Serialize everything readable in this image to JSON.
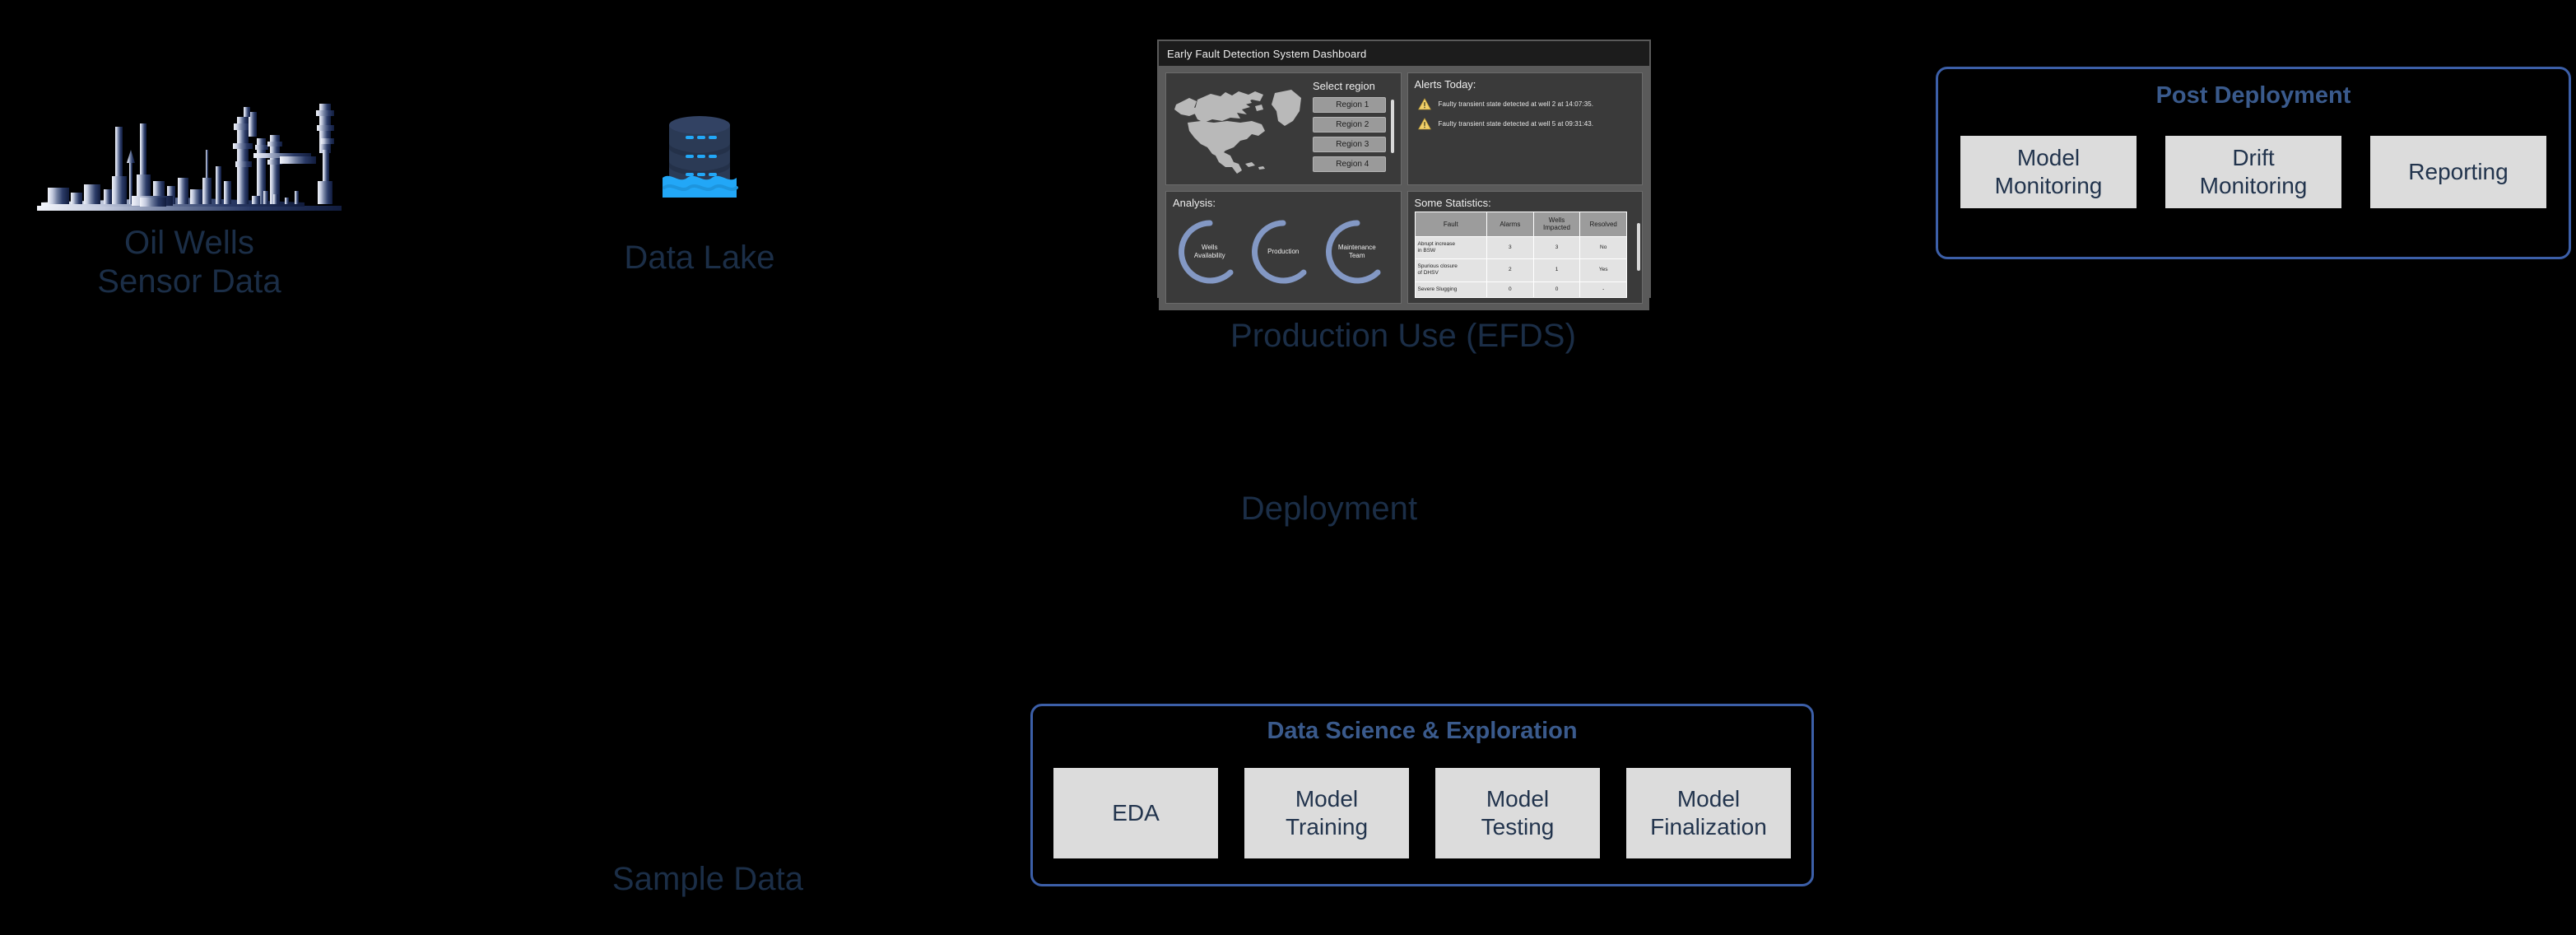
{
  "stage": {
    "background_color": "#000000",
    "caption_color": "#1b2e47",
    "accent_blue": "#3c5fa8",
    "group_title_color": "#3a5a8c",
    "group_item_bg": "#dcdcdc"
  },
  "sources": {
    "oil_wells": {
      "caption": "Oil Wells\nSensor Data",
      "icon": "refinery-silhouette-icon"
    },
    "data_lake": {
      "caption": "Data Lake",
      "icon": "data-lake-icon"
    }
  },
  "stage_labels": {
    "production_use": "Production Use (EFDS)",
    "deployment": "Deployment",
    "sample_data": "Sample Data"
  },
  "efds_dashboard": {
    "title": "Early Fault Detection System Dashboard",
    "region_panel": {
      "select_label": "Select region",
      "map_icon": "north-america-map-icon",
      "regions": [
        "Region 1",
        "Region 2",
        "Region 3",
        "Region 4"
      ]
    },
    "alerts_panel": {
      "title": "Alerts Today:",
      "alert_icon": "warning-triangle-icon",
      "alerts": [
        "Faulty transient state detected at well 2 at 14:07:35.",
        "Faulty transient state detected at well 5 at 09:31:43."
      ]
    },
    "analysis_panel": {
      "title": "Analysis:",
      "gauges": [
        {
          "label": "Wells\nAvailability"
        },
        {
          "label": "Production"
        },
        {
          "label": "Maintenance\nTeam"
        }
      ],
      "gauge_color": "#8398c4"
    },
    "statistics_panel": {
      "title": "Some Statistics:",
      "columns": [
        "Fault",
        "Alarms",
        "Wells\nImpacted",
        "Resolved"
      ],
      "rows": [
        {
          "fault": "Abrupt increase\nin BSW",
          "alarms": "3",
          "wells_impacted": "3",
          "resolved": "No"
        },
        {
          "fault": "Spurious closure\nof DHSV",
          "alarms": "2",
          "wells_impacted": "1",
          "resolved": "Yes"
        },
        {
          "fault": "Severe Slugging",
          "alarms": "0",
          "wells_impacted": "0",
          "resolved": "-"
        }
      ]
    }
  },
  "post_deployment": {
    "title": "Post Deployment",
    "items": [
      {
        "label": "Model\nMonitoring"
      },
      {
        "label": "Drift\nMonitoring"
      },
      {
        "label": "Reporting"
      }
    ]
  },
  "data_science": {
    "title": "Data Science & Exploration",
    "items": [
      {
        "label": "EDA"
      },
      {
        "label": "Model\nTraining"
      },
      {
        "label": "Model\nTesting"
      },
      {
        "label": "Model\nFinalization"
      }
    ]
  }
}
